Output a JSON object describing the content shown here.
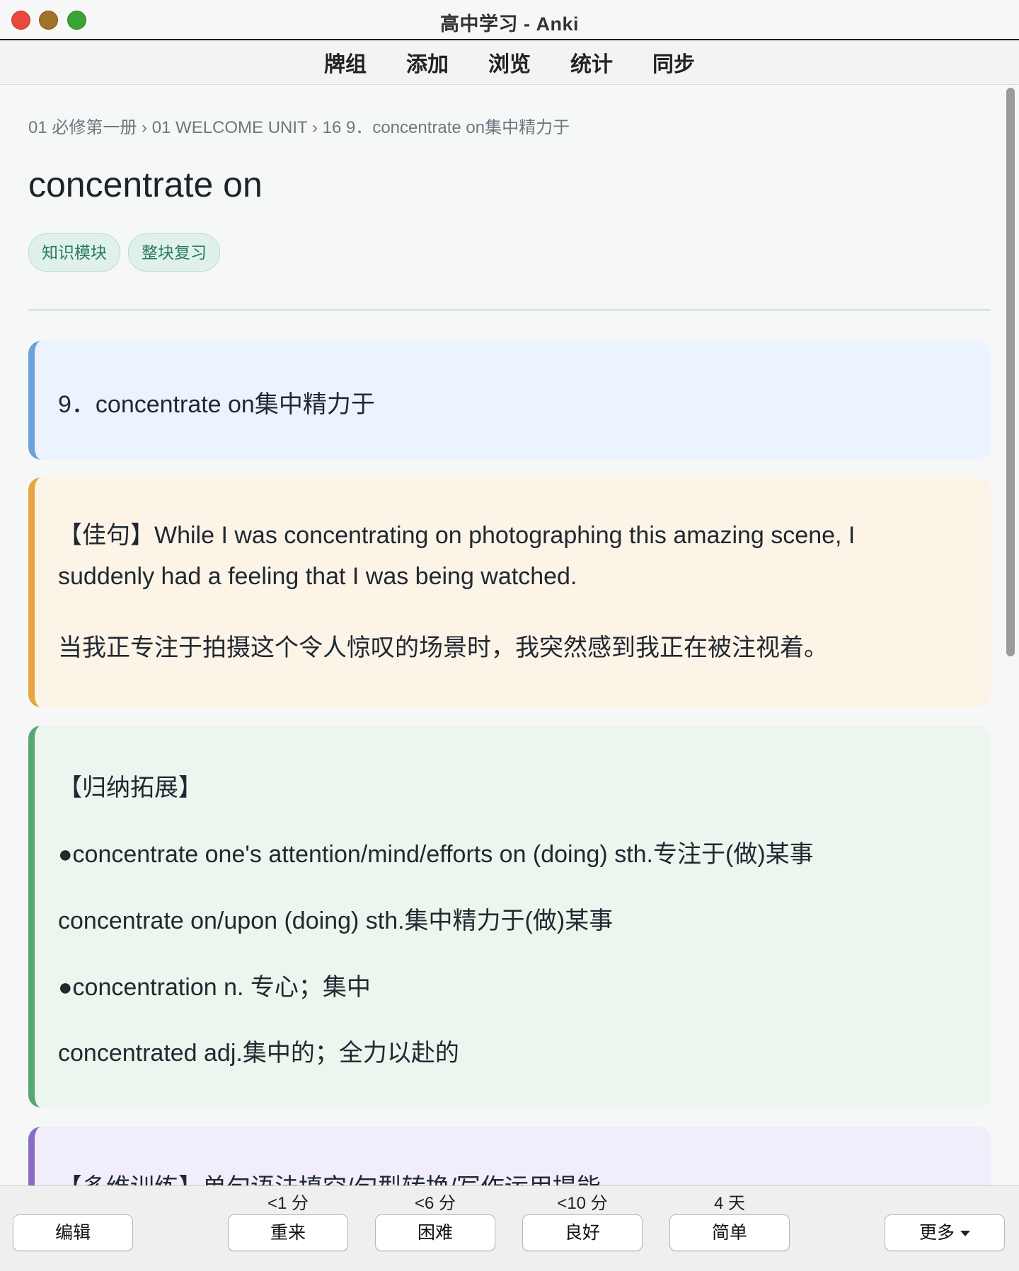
{
  "window": {
    "title": "高中学习 - Anki"
  },
  "toolbar": {
    "items": [
      "牌组",
      "添加",
      "浏览",
      "统计",
      "同步"
    ]
  },
  "card": {
    "breadcrumb": "01 必修第一册 › 01 WELCOME UNIT › 16 9．concentrate on集中精力于",
    "headword": "concentrate on",
    "tags": [
      "知识模块",
      "整块复习"
    ],
    "meaning": "9．concentrate on集中精力于",
    "example": {
      "line1": "【佳句】While I was concentrating on photographing this amazing scene, I",
      "line2": "suddenly had a feeling that I was being watched.",
      "translation": "当我正专注于拍摄这个令人惊叹的场景时，我突然感到我正在被注视着。"
    },
    "expansion": {
      "heading": "【归纳拓展】",
      "items": [
        "●concentrate one's attention/mind/efforts on (doing) sth.专注于(做)某事",
        "concentrate on/upon (doing) sth.集中精力于(做)某事",
        "●concentration n.  专心；集中",
        "concentrated adj.集中的；全力以赴的"
      ]
    },
    "training": {
      "heading": "【多维训练】单句语法填空/句型转换/写作运用提能"
    }
  },
  "answer_bar": {
    "edit": "编辑",
    "more": "更多",
    "buttons": [
      {
        "interval": "<1 分",
        "label": "重来"
      },
      {
        "interval": "<6 分",
        "label": "困难"
      },
      {
        "interval": "<10 分",
        "label": "良好"
      },
      {
        "interval": "4 天",
        "label": "简单"
      }
    ]
  }
}
